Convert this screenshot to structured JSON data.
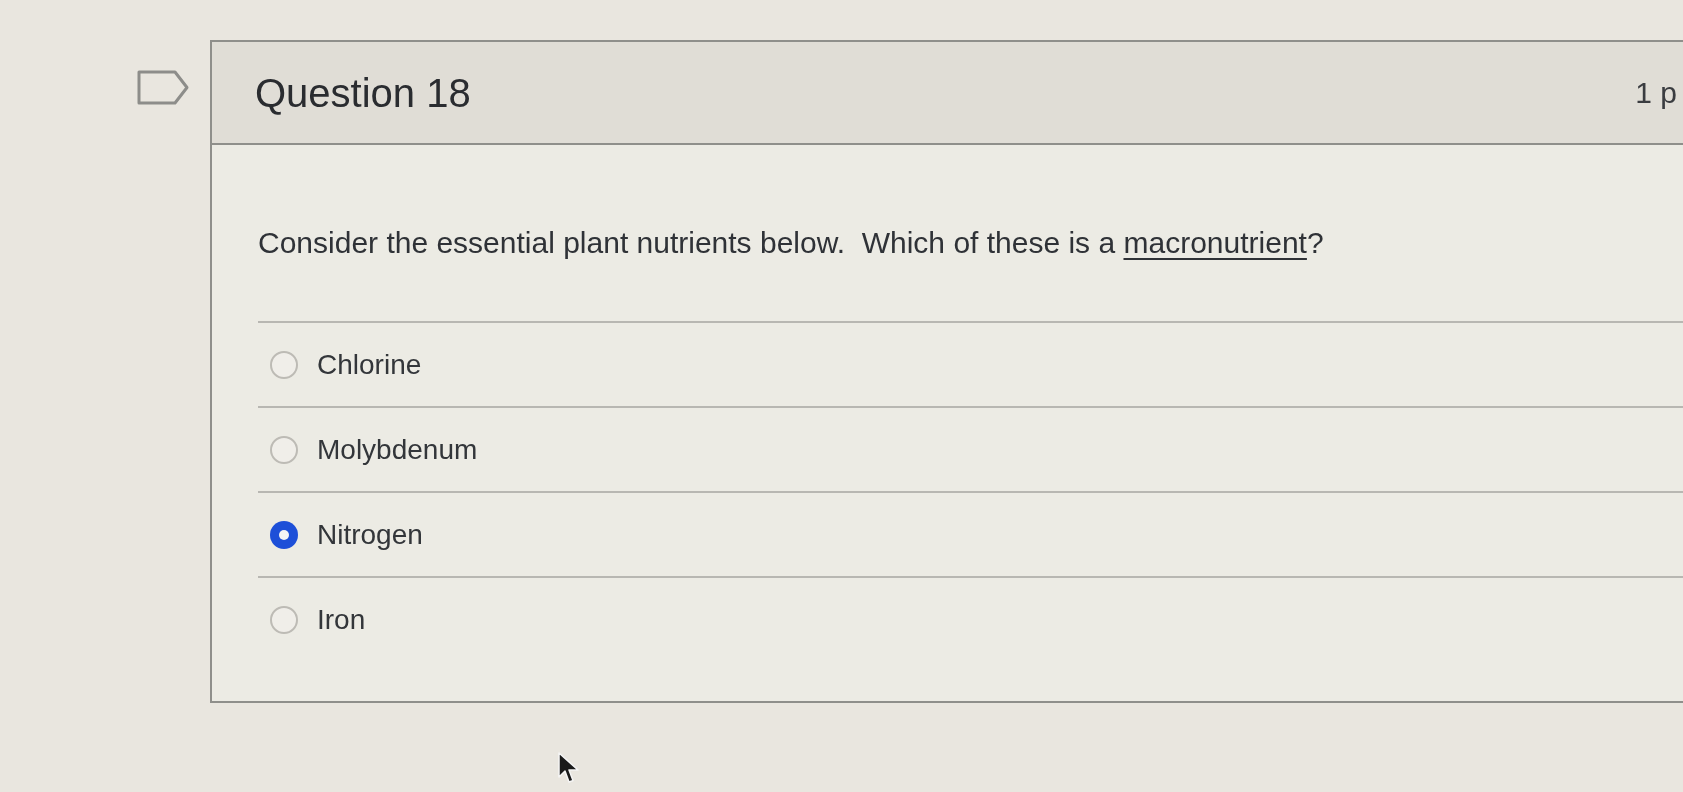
{
  "question": {
    "title": "Question 18",
    "points": "1 p",
    "prompt": [
      {
        "text": "Consider the essential plant nutrients below.  Which of these is a ",
        "underline": false
      },
      {
        "text": "macronutrient",
        "underline": true
      },
      {
        "text": "?",
        "underline": false
      }
    ]
  },
  "options": [
    {
      "label": "Chlorine",
      "selected": false
    },
    {
      "label": "Molybdenum",
      "selected": false
    },
    {
      "label": "Nitrogen",
      "selected": true
    },
    {
      "label": "Iron",
      "selected": false
    }
  ]
}
